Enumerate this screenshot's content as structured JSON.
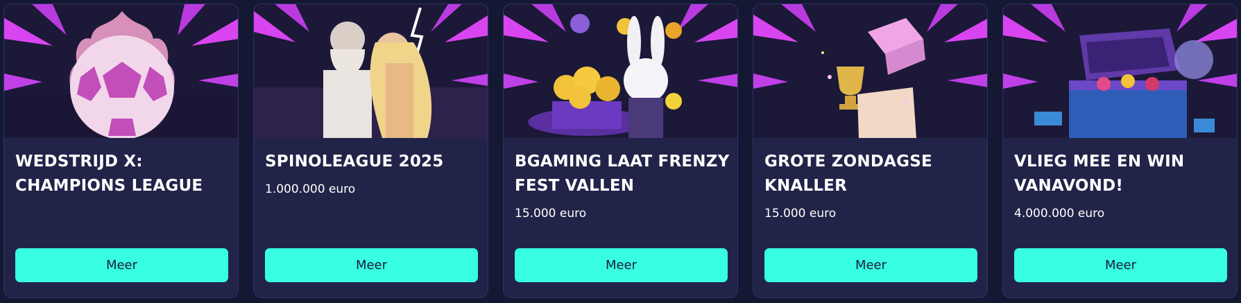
{
  "colors": {
    "page_background": "#141833",
    "card_background": "#212448",
    "button_background": "#37fde2",
    "button_text": "#1b1d3a",
    "banner_rays": "#d845f0"
  },
  "promotions": [
    {
      "title": "WEDSTRIJD X: CHAMPIONS LEAGUE",
      "amount": "",
      "button_label": "Meer",
      "image": "flaming-football-icon"
    },
    {
      "title": "SPINOLEAGUE 2025",
      "amount": "1.000.000 euro",
      "button_label": "Meer",
      "image": "zeus-and-goddess-icon"
    },
    {
      "title": "BGAMING LAAT FRENZY FEST VALLEN",
      "amount": "15.000 euro",
      "button_label": "Meer",
      "image": "rabbit-with-coins-icon"
    },
    {
      "title": "GROTE ZONDAGSE KNALLER",
      "amount": "15.000 euro",
      "button_label": "Meer",
      "image": "trophy-gift-box-icon"
    },
    {
      "title": "VLIEG MEE EN WIN VANAVOND!",
      "amount": "4.000.000 euro",
      "button_label": "Meer",
      "image": "treasure-chest-icon"
    }
  ]
}
